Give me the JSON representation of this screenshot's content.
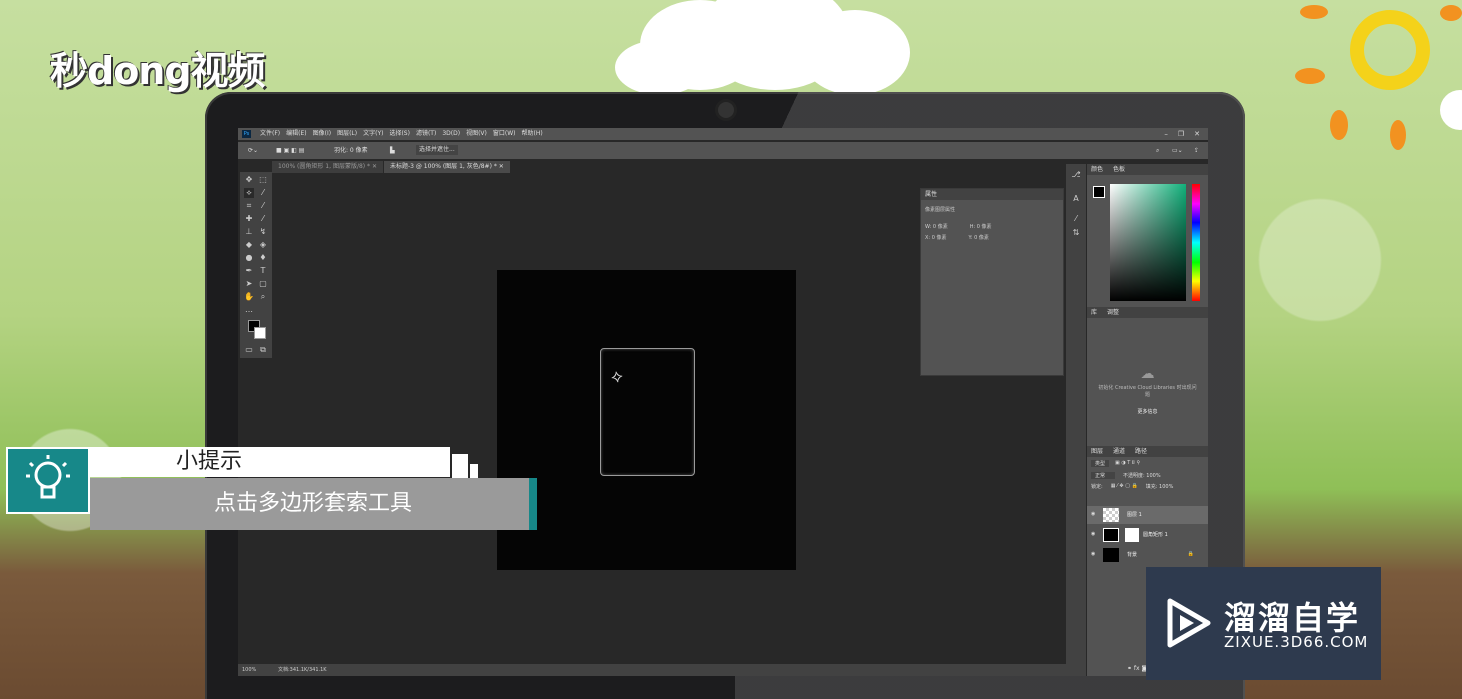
{
  "brand_top": "秒dong视频",
  "photoshop": {
    "app_icon": "Ps",
    "menus": [
      "文件(F)",
      "编辑(E)",
      "图像(I)",
      "图层(L)",
      "文字(Y)",
      "选择(S)",
      "滤镜(T)",
      "3D(D)",
      "视图(V)",
      "窗口(W)",
      "帮助(H)"
    ],
    "options": {
      "feather_label": "羽化: 0 像素",
      "select_mask": "选择并遮住..."
    },
    "tabs": [
      {
        "label": "100% (圆角矩形 1, 图层蒙版/8) *"
      },
      {
        "label": "未标题-3 @ 100% (图层 1, 灰色/8#) *"
      }
    ],
    "properties": {
      "title": "属性",
      "subtitle": "像素图层属性",
      "w": "W: 0 像素",
      "h": "H: 0 像素",
      "x": "X: 0 像素",
      "y": "Y: 0 像素"
    },
    "color_panel": {
      "tabs": [
        "颜色",
        "色板"
      ],
      "accent": "#11b07a"
    },
    "libraries": {
      "tabs": [
        "库",
        "调整"
      ],
      "message": "初始化 Creative Cloud Libraries 时出现问题",
      "more_info": "更多信息"
    },
    "layers_panel": {
      "tabs": [
        "图层",
        "通道",
        "路径"
      ],
      "kind": "类型",
      "blend": "正常",
      "opacity_label": "不透明度: 100%",
      "lock_label": "锁定:",
      "fill_label": "填充: 100%",
      "layers": [
        {
          "name": "图层 1"
        },
        {
          "name": "圆角矩形 1"
        },
        {
          "name": "背景"
        }
      ]
    },
    "status": {
      "zoom": "100%",
      "doc": "文档:341.1K/341.1K"
    }
  },
  "tip": {
    "title": "小提示",
    "text": "点击多边形套索工具"
  },
  "brand_box": {
    "name": "溜溜自学",
    "url": "ZIXUE.3D66.COM"
  }
}
